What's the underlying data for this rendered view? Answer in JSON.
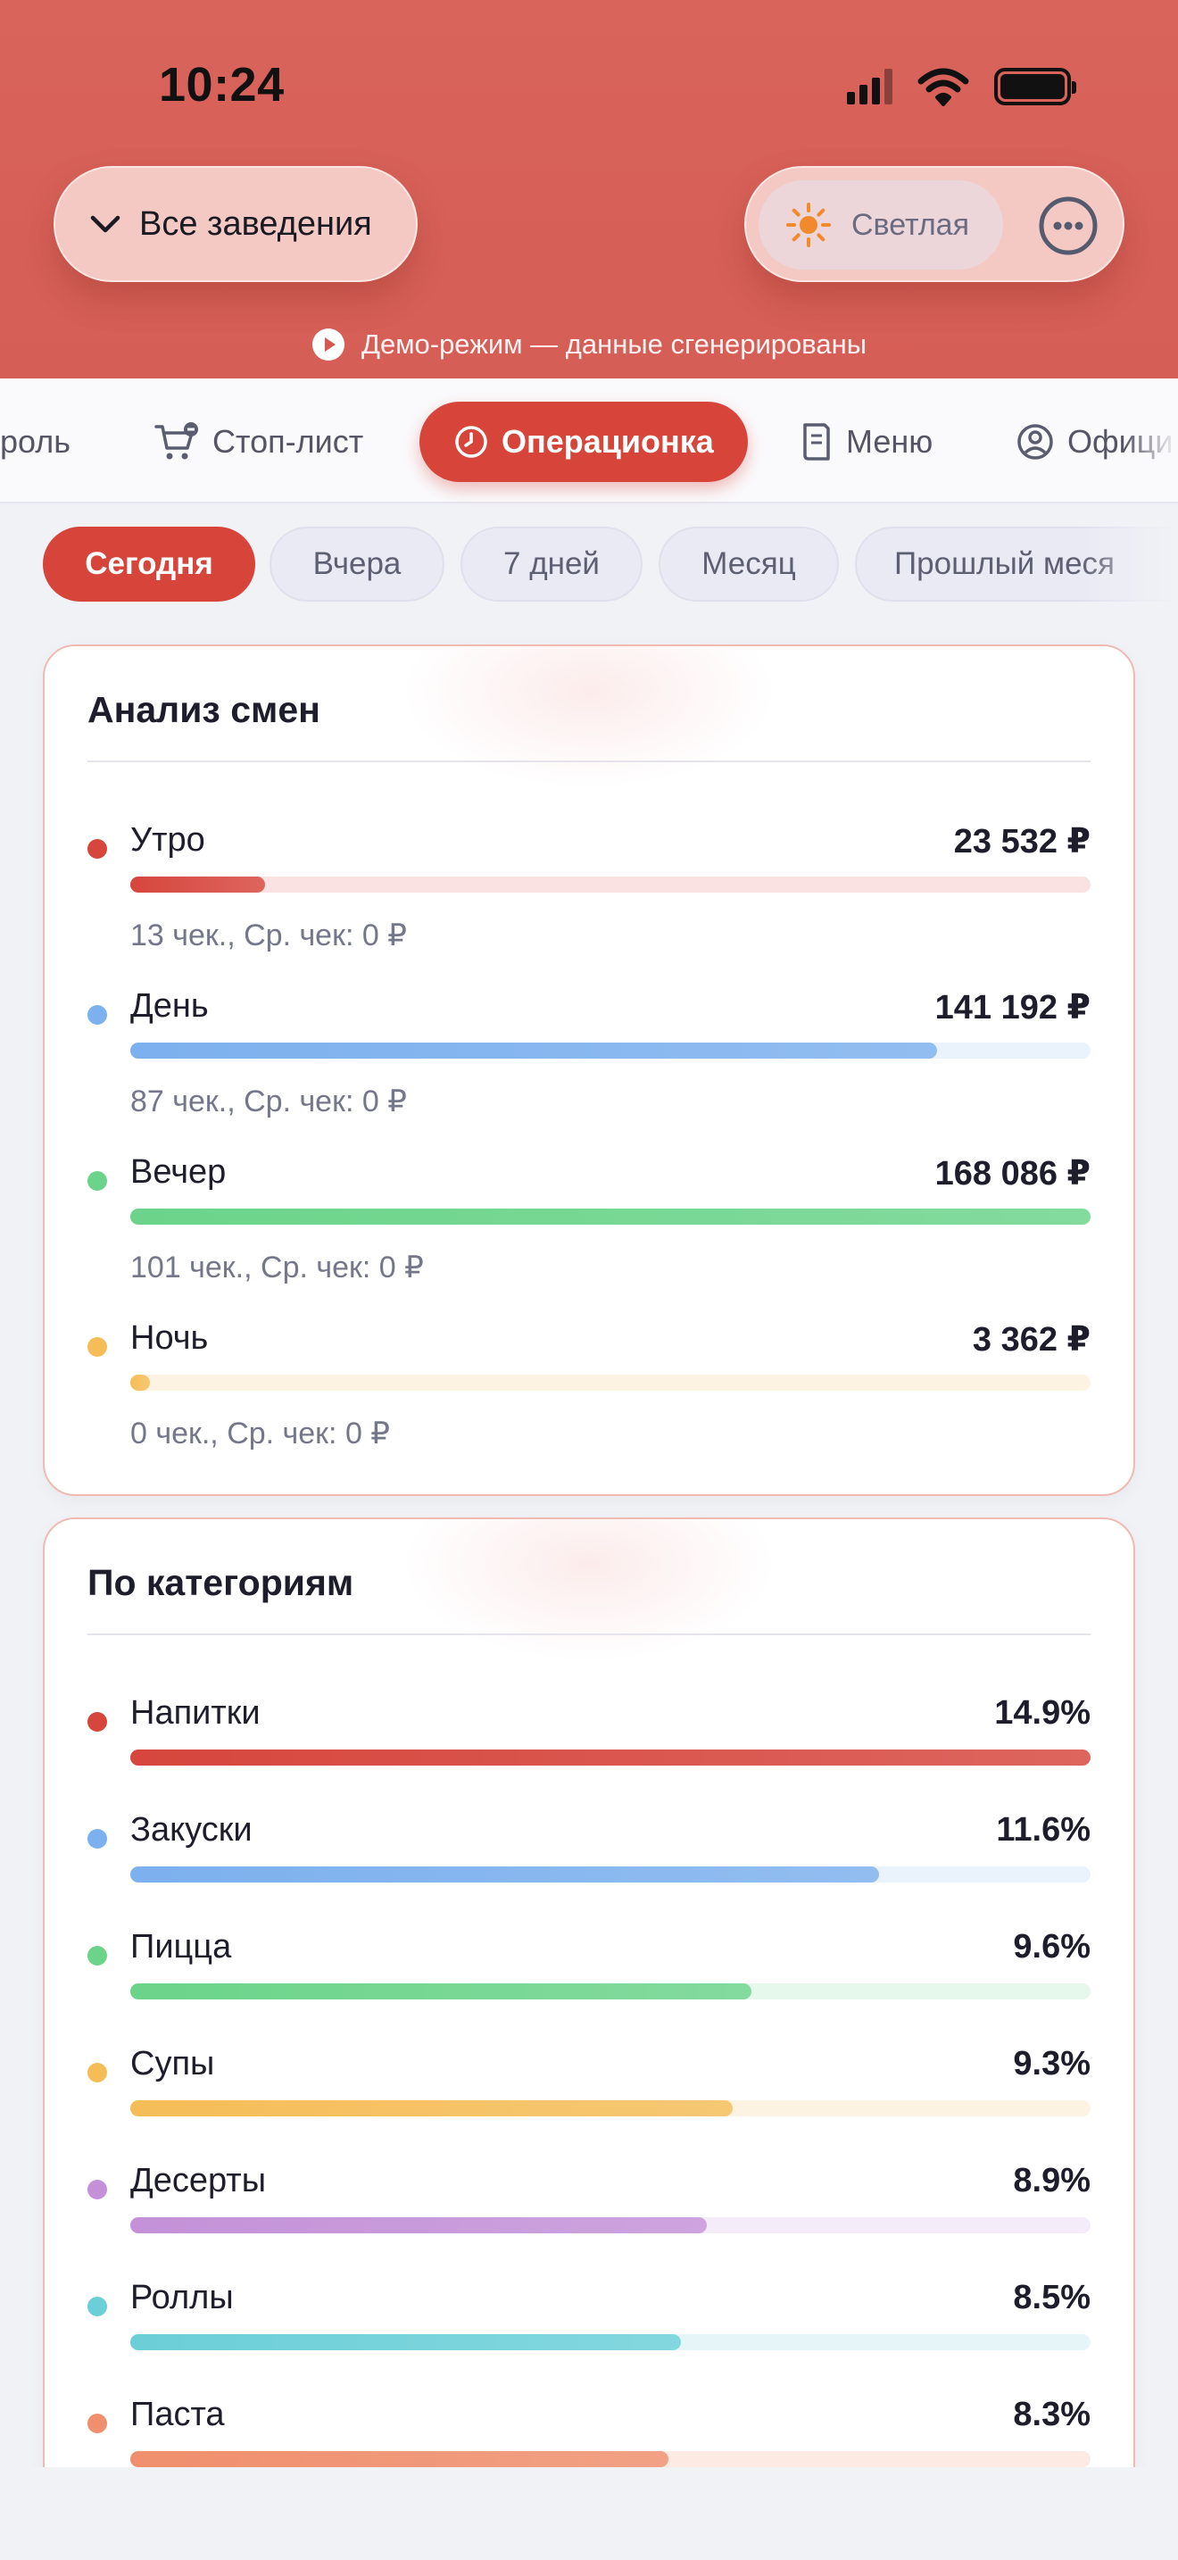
{
  "status_bar": {
    "time": "10:24"
  },
  "header": {
    "venues_label": "Все заведения",
    "theme_label": "Светлая",
    "demo_note": "Демо-режим — данные сгенерированы"
  },
  "tabs": [
    {
      "label": "роль",
      "icon": "shield-icon"
    },
    {
      "label": "Стоп-лист",
      "icon": "cart-stop-icon"
    },
    {
      "label": "Операционка",
      "icon": "clock-icon",
      "active": true
    },
    {
      "label": "Меню",
      "icon": "menu-book-icon"
    },
    {
      "label": "Офици",
      "icon": "user-circle-icon"
    }
  ],
  "periods": [
    {
      "label": "Сегодня",
      "active": true
    },
    {
      "label": "Вчера"
    },
    {
      "label": "7 дней"
    },
    {
      "label": "Месяц"
    },
    {
      "label": "Прошлый меся"
    }
  ],
  "shift_analysis": {
    "title": "Анализ смен",
    "rows": [
      {
        "name": "Утро",
        "value": "23 532 ₽",
        "fill": 0.14,
        "sub": "13 чек., Ср. чек: 0 ₽",
        "color": "#d6463d",
        "track": "#f9e2e1"
      },
      {
        "name": "День",
        "value": "141 192 ₽",
        "fill": 0.84,
        "sub": "87 чек., Ср. чек: 0 ₽",
        "color": "#7cb0ee",
        "track": "#eaf2fc"
      },
      {
        "name": "Вечер",
        "value": "168 086 ₽",
        "fill": 1.0,
        "sub": "101 чек., Ср. чек: 0 ₽",
        "color": "#6bd48a",
        "track": "#e6f7eb"
      },
      {
        "name": "Ночь",
        "value": "3 362 ₽",
        "fill": 0.02,
        "sub": "0 чек., Ср. чек: 0 ₽",
        "color": "#f5bd57",
        "track": "#fdf3e2"
      }
    ]
  },
  "categories": {
    "title": "По категориям",
    "rows": [
      {
        "name": "Напитки",
        "value": "14.9%",
        "fill": 1.0,
        "color": "#d6463d",
        "track": "#f9e2e1"
      },
      {
        "name": "Закуски",
        "value": "11.6%",
        "fill": 0.78,
        "color": "#7cb0ee",
        "track": "#eaf2fc"
      },
      {
        "name": "Пицца",
        "value": "9.6%",
        "fill": 0.647,
        "color": "#6bd48a",
        "track": "#e6f7eb"
      },
      {
        "name": "Супы",
        "value": "9.3%",
        "fill": 0.627,
        "color": "#f5bd57",
        "track": "#fdf3e2"
      },
      {
        "name": "Десерты",
        "value": "8.9%",
        "fill": 0.6,
        "color": "#c491d8",
        "track": "#f4ecf8"
      },
      {
        "name": "Роллы",
        "value": "8.5%",
        "fill": 0.573,
        "color": "#6bcfd8",
        "track": "#e6f6f8"
      },
      {
        "name": "Паста",
        "value": "8.3%",
        "fill": 0.56,
        "color": "#ef8f6d",
        "track": "#fceae3"
      }
    ]
  }
}
